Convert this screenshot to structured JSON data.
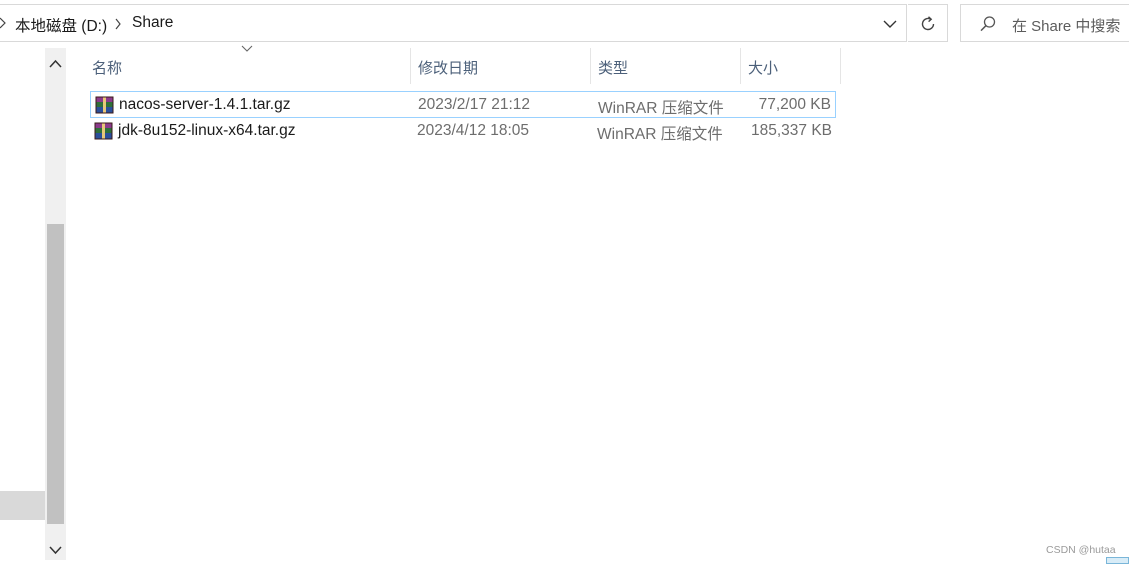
{
  "address_bar": {
    "breadcrumbs": [
      {
        "label": "本地磁盘 (D:)"
      },
      {
        "label": "Share"
      }
    ],
    "icons": {
      "back_chevron": "chevron-right-icon",
      "separator": "chevron-right-icon",
      "history": "chevron-down-icon",
      "refresh": "refresh-icon"
    }
  },
  "search": {
    "placeholder": "在 Share 中搜索",
    "icon": "search-icon"
  },
  "columns": [
    {
      "label": "名称"
    },
    {
      "label": "修改日期"
    },
    {
      "label": "类型"
    },
    {
      "label": "大小"
    }
  ],
  "files": [
    {
      "name": "nacos-server-1.4.1.tar.gz",
      "modified": "2023/2/17 21:12",
      "type": "WinRAR 压缩文件",
      "size": "77,200 KB",
      "icon": "winrar-archive-icon"
    },
    {
      "name": "jdk-8u152-linux-x64.tar.gz",
      "modified": "2023/4/12 18:05",
      "type": "WinRAR 压缩文件",
      "size": "185,337 KB",
      "icon": "winrar-archive-icon"
    }
  ],
  "watermark": "CSDN @hutaa",
  "colors": {
    "header_text": "#4c607a",
    "focus_border": "#99d1ff",
    "scroll_thumb": "#c1c1c1"
  }
}
